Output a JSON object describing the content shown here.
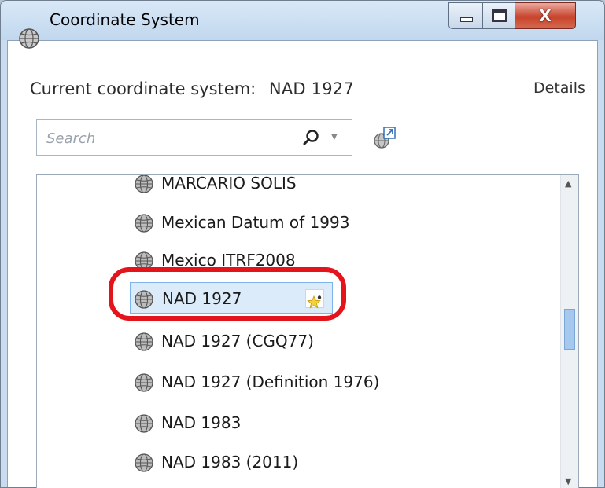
{
  "window": {
    "title": "Coordinate System",
    "close_glyph": "X"
  },
  "header": {
    "current_prefix": "Current coordinate system:",
    "current_value": "NAD 1927",
    "details_link": "Details"
  },
  "search": {
    "placeholder": "Search",
    "value": ""
  },
  "list": {
    "items": [
      {
        "label": "MARCARIO SOLIS",
        "icon": "globe-icon",
        "selected": false
      },
      {
        "label": "Mexican Datum of 1993",
        "icon": "globe-icon",
        "selected": false
      },
      {
        "label": "Mexico ITRF2008",
        "icon": "globe-icon",
        "selected": false
      },
      {
        "label": "NAD 1927",
        "icon": "globe-icon",
        "selected": true,
        "favorite": true
      },
      {
        "label": "NAD 1927 (CGQ77)",
        "icon": "globe-icon",
        "selected": false
      },
      {
        "label": "NAD 1927 (Definition 1976)",
        "icon": "globe-icon",
        "selected": false
      },
      {
        "label": "NAD 1983",
        "icon": "globe-icon",
        "selected": false
      },
      {
        "label": "NAD 1983 (2011)",
        "icon": "globe-icon",
        "selected": false
      }
    ]
  },
  "colors": {
    "highlight": "#e4141c",
    "selection": "#dcebf9",
    "accent": "#7eb4ea"
  }
}
